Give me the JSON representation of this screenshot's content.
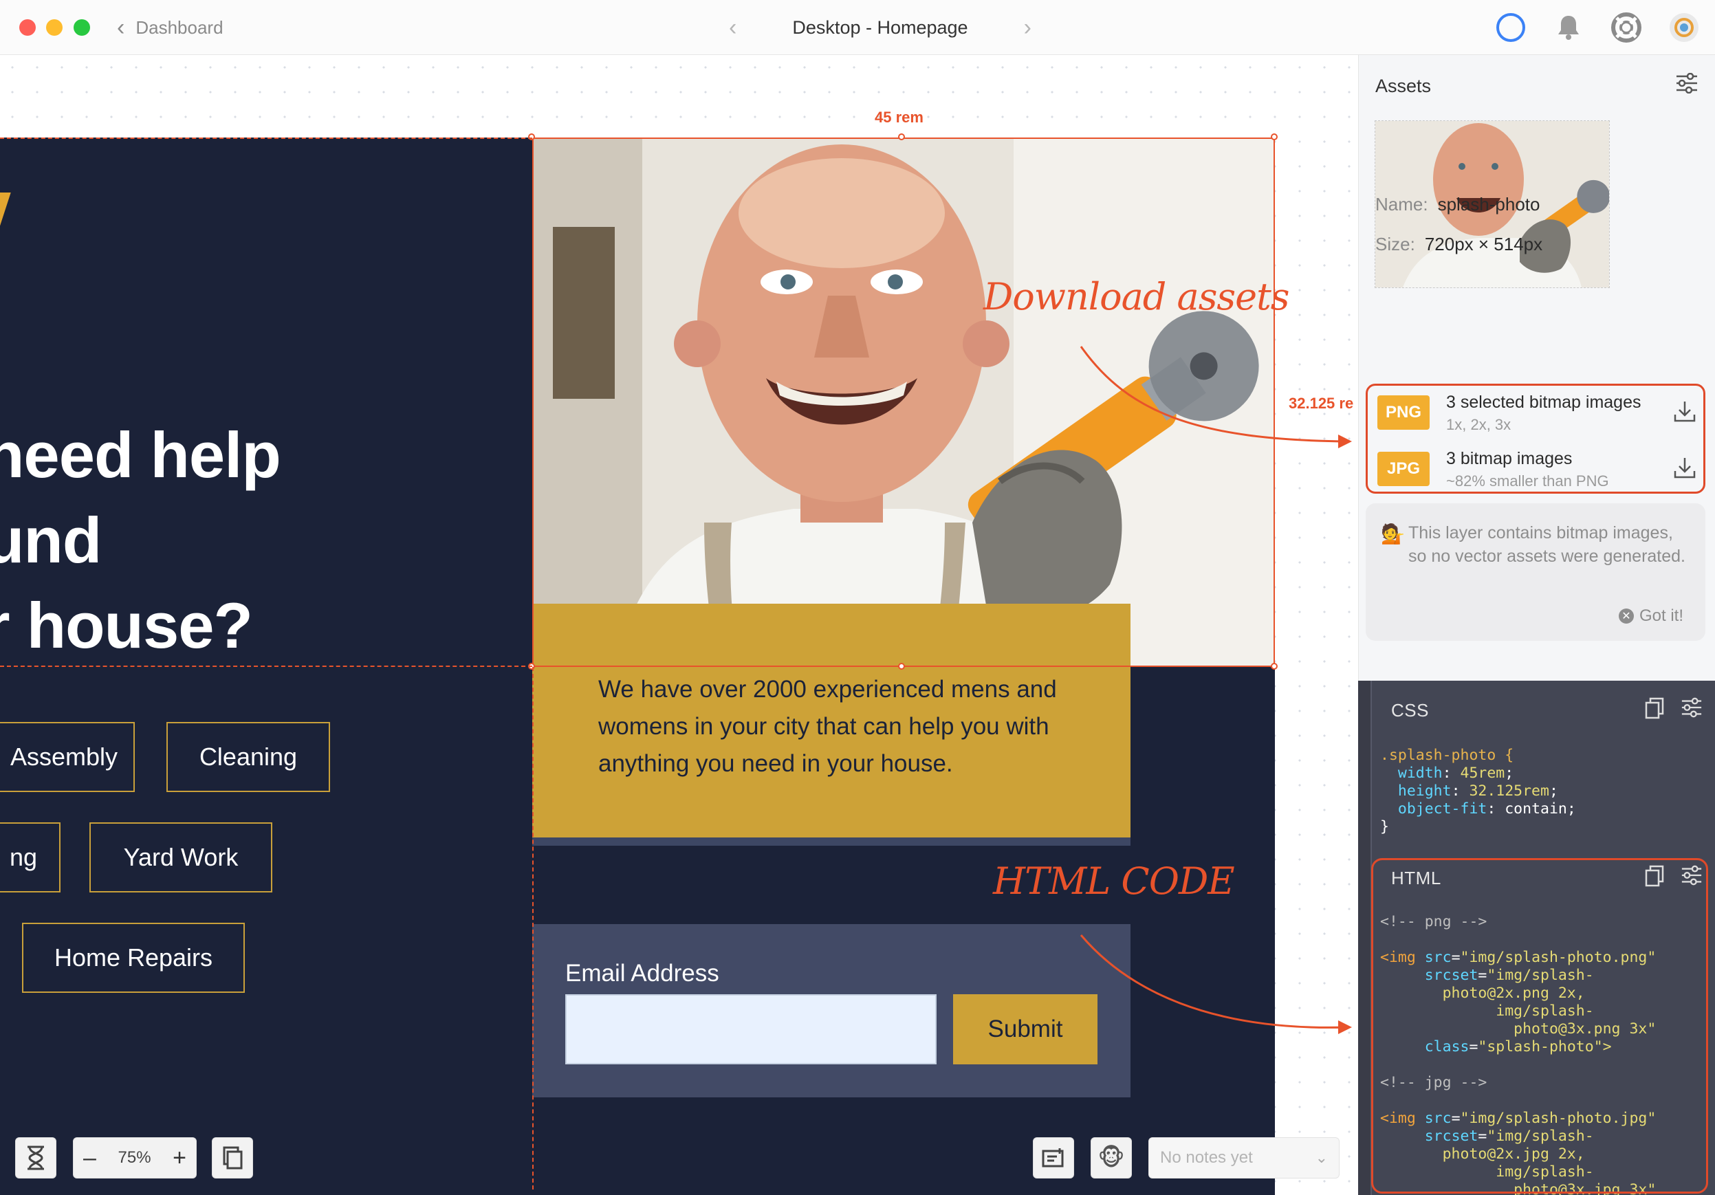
{
  "window": {
    "back_label": "Dashboard",
    "title": "Desktop - Homepage"
  },
  "canvas": {
    "headline": [
      "need help",
      "und",
      "r house?"
    ],
    "chips": [
      "Assembly",
      "Cleaning",
      "ng",
      "Yard Work",
      "Home Repairs"
    ],
    "description": "We have over 2000 experienced mens and womens in your city that can help you with anything you need in your house.",
    "email_label": "Email Address",
    "email_value": "",
    "submit_label": "Submit",
    "width_measure": "45 rem",
    "height_measure": "32.125 re",
    "annotation_download": "Download assets",
    "annotation_html": "HTML CODE"
  },
  "toolbar": {
    "zoom_minus": "–",
    "zoom_value": "75%",
    "zoom_plus": "+",
    "notes_placeholder": "No notes yet"
  },
  "assets": {
    "title": "Assets",
    "name_label": "Name:",
    "name_value": "splash-photo",
    "size_label": "Size:",
    "size_value": "720px × 514px",
    "png_badge": "PNG",
    "png_title": "3 selected bitmap images",
    "png_sub": "1x, 2x, 3x",
    "jpg_badge": "JPG",
    "jpg_title": "3 bitmap images",
    "jpg_sub": "~82% smaller than PNG",
    "info_emoji": "💁",
    "info_text": "This layer contains bitmap images, so no vector assets were generated.",
    "gotit_label": "Got it!"
  },
  "css_panel": {
    "title": "CSS",
    "lines": [
      {
        "sel": ".splash-photo {"
      },
      {
        "prop": "width",
        "val": "45rem"
      },
      {
        "prop": "height",
        "val": "32.125rem"
      },
      {
        "prop": "object-fit",
        "val": "contain"
      },
      {
        "plain": "}"
      }
    ]
  },
  "html_panel": {
    "title": "HTML",
    "comment_png": "<!-- png -->",
    "png_src": "\"img/splash-photo.png\"",
    "png_srcset_1": "\"img/splash-",
    "png_srcset_2": "photo@2x.png 2x,",
    "png_srcset_3": "img/splash-",
    "png_srcset_4": "photo@3x.png 3x\"",
    "class_attr": "\"splash-photo\">",
    "comment_jpg": "<!-- jpg -->",
    "jpg_src": "\"img/splash-photo.jpg\"",
    "jpg_srcset_1": "\"img/splash-",
    "jpg_srcset_2": "photo@2x.jpg 2x,",
    "jpg_srcset_3": "img/splash-",
    "jpg_srcset_4": "photo@3x.jpg 3x\""
  },
  "colors": {
    "dark_bg": "#1b2238",
    "accent_gold": "#cda237",
    "annotation_red": "#e8532b",
    "png_badge": "#f2ae2f"
  },
  "icons": [
    "chevron-left-icon",
    "chevron-right-icon",
    "circle-status-icon",
    "bell-icon",
    "lifebuoy-icon",
    "avatar",
    "sliders-icon",
    "download-icon",
    "copy-icon",
    "hourglass-icon",
    "layers-icon",
    "add-note-icon",
    "monkey-icon"
  ]
}
